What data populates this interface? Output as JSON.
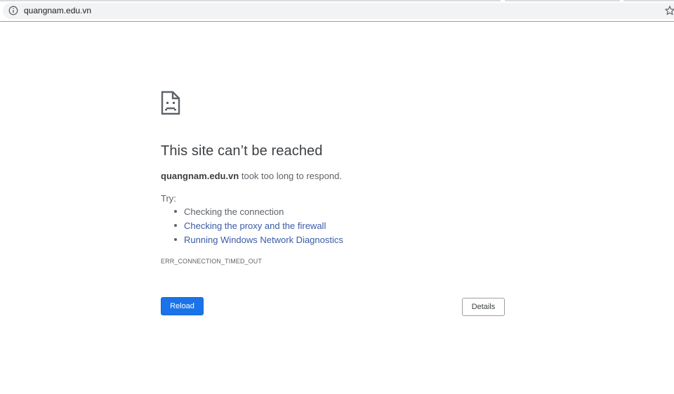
{
  "browser": {
    "url": "quangnam.edu.vn",
    "info_icon": "info-circle-icon",
    "bookmark_icon": "star-outline-icon"
  },
  "error_page": {
    "icon": "sad-document-icon",
    "title": "This site can’t be reached",
    "host": "quangnam.edu.vn",
    "summary_suffix": " took too long to respond.",
    "try_label": "Try:",
    "suggestions": [
      "Checking the connection",
      "Checking the proxy and the firewall",
      "Running Windows Network Diagnostics"
    ],
    "error_code": "ERR_CONNECTION_TIMED_OUT",
    "reload_label": "Reload",
    "details_label": "Details"
  },
  "colors": {
    "primary_button": "#1a73e8",
    "link": "#3b5ba4",
    "text": "#5f6368",
    "title": "#3c4043"
  }
}
